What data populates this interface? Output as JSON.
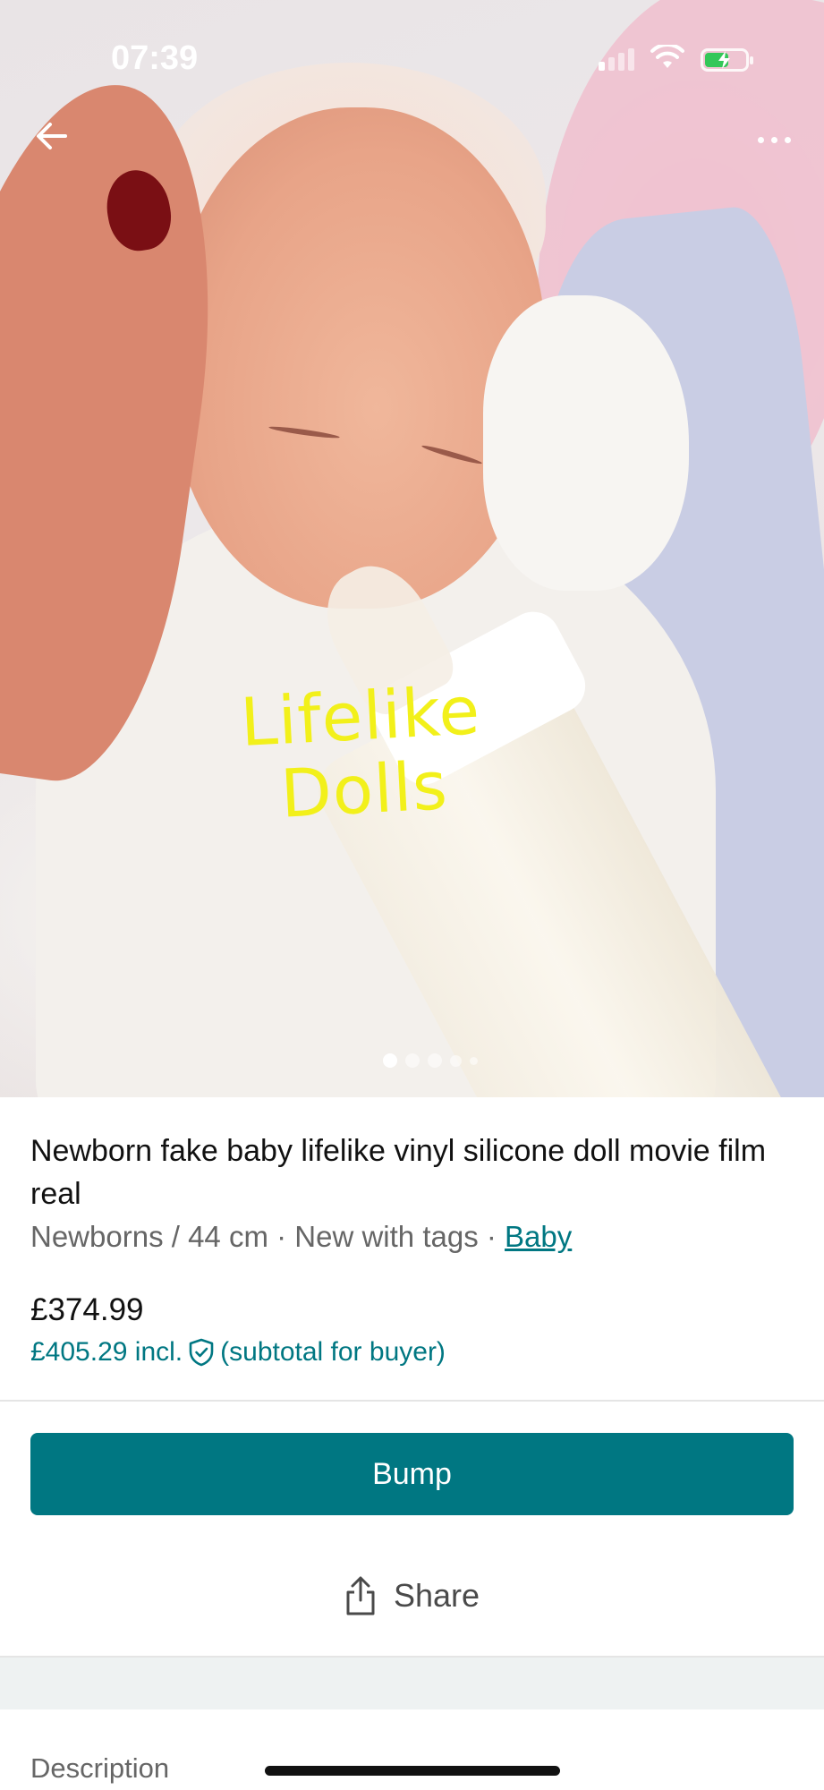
{
  "status_bar": {
    "time": "07:39",
    "signal_bars_on": 1,
    "signal_bars_total": 4,
    "battery_level": 0.6
  },
  "hero": {
    "watermark_line1": "Lifelike",
    "watermark_line2": "Dolls",
    "current_image": 1,
    "image_count": 5
  },
  "icons": {
    "back": "arrow-left-icon",
    "more": "more-horizontal-icon",
    "share": "share-icon",
    "shield": "shield-check-icon",
    "wifi": "wifi-icon",
    "battery": "battery-charging-icon"
  },
  "item": {
    "title": "Newborn fake baby lifelike vinyl silicone doll movie film real",
    "size": "Newborns / 44 cm",
    "separator": "·",
    "condition": "New with tags",
    "category_link": "Baby",
    "price": "£374.99",
    "price_incl": "£405.29 incl.",
    "price_incl_note": "(subtotal for buyer)"
  },
  "actions": {
    "bump_label": "Bump",
    "share_label": "Share"
  },
  "sections": {
    "description_label": "Description"
  },
  "colors": {
    "accent": "#007782",
    "watermark": "#f2f01a",
    "battery_charge": "#34c759"
  }
}
